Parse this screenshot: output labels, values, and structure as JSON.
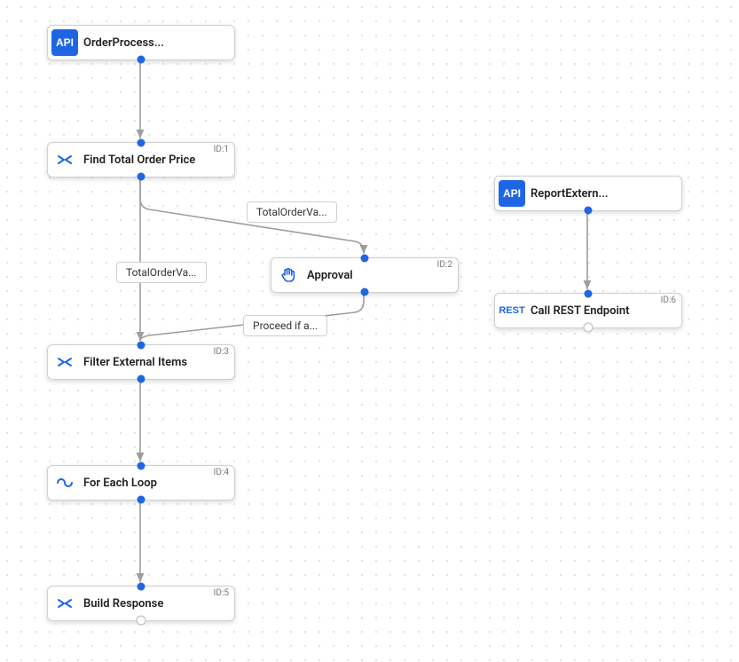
{
  "nodes": {
    "start1": {
      "label": "OrderProcess...",
      "id": ""
    },
    "n1": {
      "label": "Find Total Order Price",
      "id": "ID:1"
    },
    "n2": {
      "label": "Approval",
      "id": "ID:2"
    },
    "n3": {
      "label": "Filter External Items",
      "id": "ID:3"
    },
    "n4": {
      "label": "For Each Loop",
      "id": "ID:4"
    },
    "n5": {
      "label": "Build Response",
      "id": "ID:5"
    },
    "start2": {
      "label": "ReportExtern...",
      "id": ""
    },
    "n6": {
      "label": "Call REST Endpoint",
      "id": "ID:6"
    }
  },
  "edgeLabels": {
    "e_n1_n2": "TotalOrderVa...",
    "e_n1_n3": "TotalOrderVa...",
    "e_n2_n3": "Proceed if a..."
  },
  "chart_data": {
    "type": "flow",
    "nodes": [
      {
        "id": "start1",
        "kind": "API",
        "label": "OrderProcess..."
      },
      {
        "id": "1",
        "kind": "DataMapper",
        "label": "Find Total Order Price"
      },
      {
        "id": "2",
        "kind": "Approval",
        "label": "Approval"
      },
      {
        "id": "3",
        "kind": "DataMapper",
        "label": "Filter External Items"
      },
      {
        "id": "4",
        "kind": "ForEach",
        "label": "For Each Loop"
      },
      {
        "id": "5",
        "kind": "DataMapper",
        "label": "Build Response"
      },
      {
        "id": "start2",
        "kind": "API",
        "label": "ReportExtern..."
      },
      {
        "id": "6",
        "kind": "REST",
        "label": "Call REST Endpoint"
      }
    ],
    "edges": [
      {
        "from": "start1",
        "to": "1"
      },
      {
        "from": "1",
        "to": "2",
        "label": "TotalOrderVa..."
      },
      {
        "from": "1",
        "to": "3",
        "label": "TotalOrderVa..."
      },
      {
        "from": "2",
        "to": "3",
        "label": "Proceed if a..."
      },
      {
        "from": "3",
        "to": "4"
      },
      {
        "from": "4",
        "to": "5"
      },
      {
        "from": "start2",
        "to": "6"
      }
    ]
  }
}
